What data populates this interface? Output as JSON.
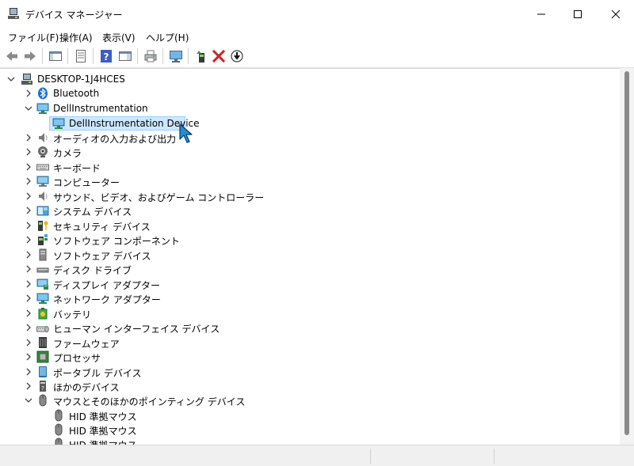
{
  "window": {
    "title": "デバイス マネージャー"
  },
  "menu": [
    "ファイル(F)",
    "操作(A)",
    "表示(V)",
    "ヘルプ(H)"
  ],
  "tree": {
    "root": "DESKTOP-1J4HCES",
    "items": [
      {
        "label": "Bluetooth",
        "icon": "bluetooth-icon",
        "expanded": false
      },
      {
        "label": "DellInstrumentation",
        "icon": "monitor-network-icon",
        "expanded": true,
        "children": [
          {
            "label": "DellInstrumentation Device",
            "icon": "monitor-network-icon",
            "selected": true
          }
        ]
      },
      {
        "label": "オーディオの入力および出力",
        "icon": "speaker-icon",
        "expanded": false
      },
      {
        "label": "カメラ",
        "icon": "camera-icon",
        "expanded": false
      },
      {
        "label": "キーボード",
        "icon": "keyboard-icon",
        "expanded": false
      },
      {
        "label": "コンピューター",
        "icon": "computer-icon",
        "expanded": false
      },
      {
        "label": "サウンド、ビデオ、およびゲーム コントローラー",
        "icon": "speaker-icon",
        "expanded": false
      },
      {
        "label": "システム デバイス",
        "icon": "system-folder-icon",
        "expanded": false
      },
      {
        "label": "セキュリティ デバイス",
        "icon": "security-key-icon",
        "expanded": false
      },
      {
        "label": "ソフトウェア コンポーネント",
        "icon": "software-component-icon",
        "expanded": false
      },
      {
        "label": "ソフトウェア デバイス",
        "icon": "software-device-icon",
        "expanded": false
      },
      {
        "label": "ディスク ドライブ",
        "icon": "disk-drive-icon",
        "expanded": false
      },
      {
        "label": "ディスプレイ アダプター",
        "icon": "display-adapter-icon",
        "expanded": false
      },
      {
        "label": "ネットワーク アダプター",
        "icon": "network-adapter-icon",
        "expanded": false
      },
      {
        "label": "バッテリ",
        "icon": "battery-icon",
        "expanded": false
      },
      {
        "label": "ヒューマン インターフェイス デバイス",
        "icon": "hid-icon",
        "expanded": false
      },
      {
        "label": "ファームウェア",
        "icon": "firmware-icon",
        "expanded": false
      },
      {
        "label": "プロセッサ",
        "icon": "processor-icon",
        "expanded": false
      },
      {
        "label": "ポータブル デバイス",
        "icon": "portable-device-icon",
        "expanded": false
      },
      {
        "label": "ほかのデバイス",
        "icon": "other-device-icon",
        "expanded": false
      },
      {
        "label": "マウスとそのほかのポインティング デバイス",
        "icon": "mouse-icon",
        "expanded": true,
        "children": [
          {
            "label": "HID 準拠マウス",
            "icon": "mouse-icon"
          },
          {
            "label": "HID 準拠マウス",
            "icon": "mouse-icon"
          },
          {
            "label": "HID 準拠マウス",
            "icon": "mouse-icon"
          }
        ]
      }
    ]
  },
  "colors": {
    "selection": "#cce8ff",
    "selection_border": "#99d1ff",
    "accent": "#0078d4",
    "close_red": "#d42020"
  }
}
